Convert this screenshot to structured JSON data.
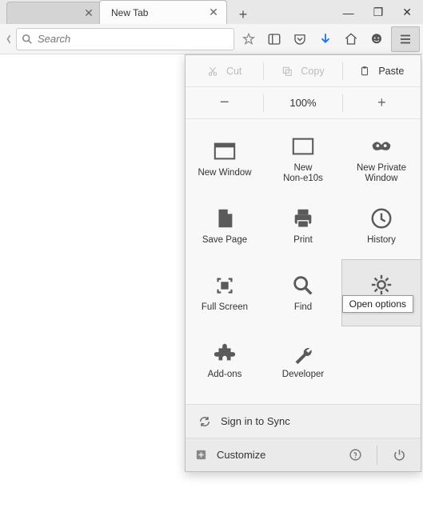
{
  "window": {
    "tab_active_title": "New Tab",
    "minimize": "—",
    "maximize": "❐",
    "close": "✕",
    "tab_close": "✕",
    "new_tab": "+"
  },
  "toolbar": {
    "search_placeholder": "Search"
  },
  "menu": {
    "edit": {
      "cut": "Cut",
      "copy": "Copy",
      "paste": "Paste"
    },
    "zoom": {
      "out": "−",
      "level": "100%",
      "in": "+"
    },
    "items": [
      {
        "label": "New Window"
      },
      {
        "label": "New\nNon-e10s"
      },
      {
        "label": "New Private\nWindow"
      },
      {
        "label": "Save Page"
      },
      {
        "label": "Print"
      },
      {
        "label": "History"
      },
      {
        "label": "Full Screen"
      },
      {
        "label": "Find"
      },
      {
        "label": "Options"
      },
      {
        "label": "Add-ons"
      },
      {
        "label": "Developer"
      }
    ],
    "options_tooltip": "Open options",
    "sync": "Sign in to Sync",
    "customize": "Customize"
  }
}
